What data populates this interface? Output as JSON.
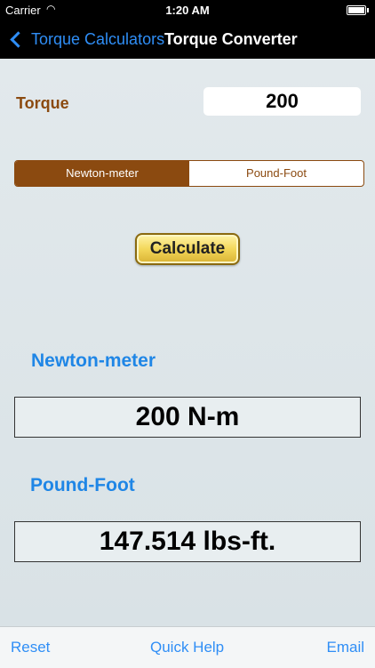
{
  "status": {
    "carrier": "Carrier",
    "time": "1:20 AM"
  },
  "nav": {
    "back_label": "Torque Calculators",
    "title": "Torque Converter"
  },
  "form": {
    "torque_label": "Torque",
    "torque_value": "200",
    "segments": [
      "Newton-meter",
      "Pound-Foot"
    ],
    "selected_segment": "Newton-meter",
    "calculate_label": "Calculate"
  },
  "results": {
    "nm_label": "Newton-meter",
    "nm_value": "200 N-m",
    "lbft_label": "Pound-Foot",
    "lbft_value": "147.514 lbs-ft."
  },
  "toolbar": {
    "reset": "Reset",
    "help": "Quick Help",
    "email": "Email"
  },
  "colors": {
    "accent_brown": "#8b4a10",
    "link_blue": "#2f8ef6",
    "label_blue": "#1f86e6"
  }
}
